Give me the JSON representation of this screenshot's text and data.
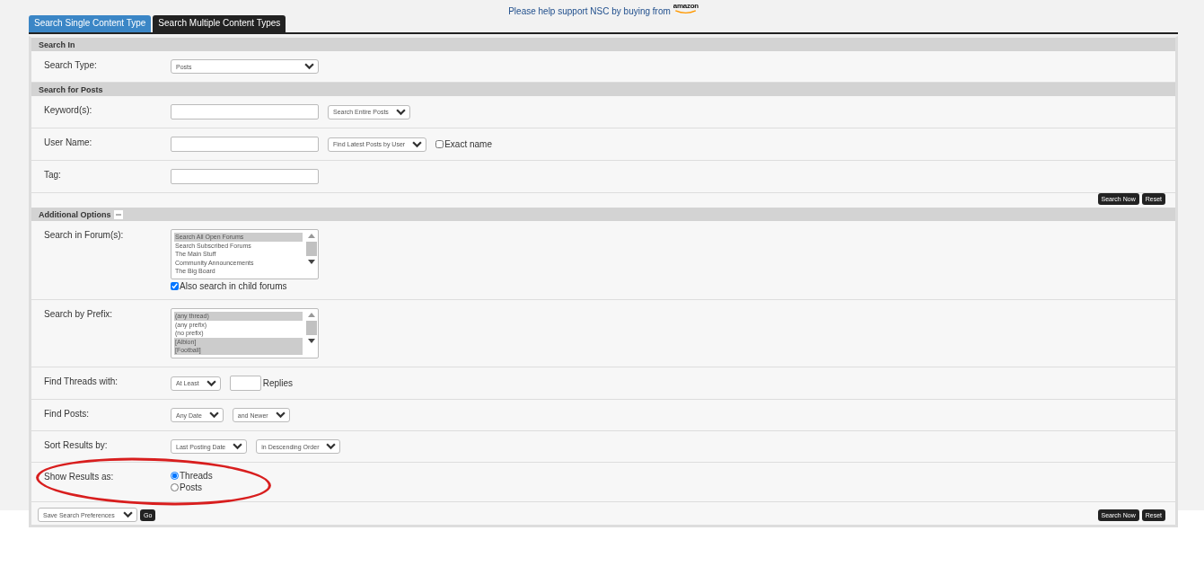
{
  "banner": {
    "text": "Please help support NSC by buying from",
    "logo": "amazon"
  },
  "tabs": [
    {
      "label": "Search Single Content Type",
      "selected": false
    },
    {
      "label": "Search Multiple Content Types",
      "selected": true
    }
  ],
  "sections": [
    {
      "title": "Search In",
      "rows": [
        {
          "label": "Search Type:",
          "lines": [
            [
              {
                "kind": "select",
                "value": "Posts"
              }
            ]
          ]
        }
      ]
    },
    {
      "title": "Search for Posts",
      "rows": [
        {
          "label": "Keyword(s):",
          "lines": [
            [
              {
                "kind": "text"
              },
              {
                "kind": "select",
                "value": "Search Entire Posts"
              }
            ]
          ]
        },
        {
          "label": "User Name:",
          "lines": [
            [
              {
                "kind": "text"
              },
              {
                "kind": "select",
                "value": "Find Latest Posts by User"
              },
              {
                "kind": "checkbox",
                "label": "Exact name",
                "checked": false
              }
            ]
          ]
        },
        {
          "label": "Tag:",
          "lines": [
            [
              {
                "kind": "text"
              }
            ]
          ]
        }
      ],
      "buttons": [
        "Search Now",
        "Reset"
      ]
    },
    {
      "title": "Additional Options",
      "expanded": true,
      "rows": [
        {
          "label": "Search in Forum(s):",
          "lines": [
            [
              {
                "kind": "listbox",
                "options": [
                  {
                    "label": "Search All Open Forums",
                    "selected": true
                  },
                  {
                    "label": "Search Subscribed Forums",
                    "selected": false
                  },
                  {
                    "label": "The Main Stuff",
                    "selected": false
                  },
                  {
                    "label": "Community Announcements",
                    "selected": false
                  },
                  {
                    "label": "The Big Board",
                    "selected": false
                  }
                ]
              }
            ],
            [
              {
                "kind": "checkbox",
                "label": "Also search in child forums",
                "checked": true
              }
            ]
          ]
        },
        {
          "label": "Search by Prefix:",
          "lines": [
            [
              {
                "kind": "listbox",
                "options": [
                  {
                    "label": "(any thread)",
                    "selected": true
                  },
                  {
                    "label": "(any prefix)",
                    "selected": false
                  },
                  {
                    "label": "(no prefix)",
                    "selected": false
                  },
                  {
                    "label": "[Albion]",
                    "selected": true
                  },
                  {
                    "label": "[Football]",
                    "selected": true
                  }
                ]
              }
            ]
          ]
        },
        {
          "label": "Find Threads with:",
          "lines": [
            [
              {
                "kind": "select",
                "value": "At Least"
              },
              {
                "kind": "count"
              },
              {
                "kind": "note",
                "text": "Replies"
              }
            ]
          ]
        },
        {
          "label": "Find Posts:",
          "lines": [
            [
              {
                "kind": "select",
                "value": "Any Date"
              },
              {
                "kind": "select",
                "value": "and Newer"
              }
            ]
          ]
        },
        {
          "label": "Sort Results by:",
          "lines": [
            [
              {
                "kind": "select",
                "value": "Last Posting Date"
              },
              {
                "kind": "select",
                "value": "in Descending Order"
              }
            ]
          ]
        },
        {
          "label": "Show Results as:",
          "lines": [
            [
              {
                "kind": "radio",
                "label": "Threads",
                "selected": true
              }
            ],
            [
              {
                "kind": "radio",
                "label": "Posts",
                "selected": false
              }
            ]
          ]
        }
      ]
    }
  ],
  "footer": {
    "preferences": "Save Search Preferences",
    "go": "Go",
    "buttons": [
      "Search Now",
      "Reset"
    ]
  }
}
